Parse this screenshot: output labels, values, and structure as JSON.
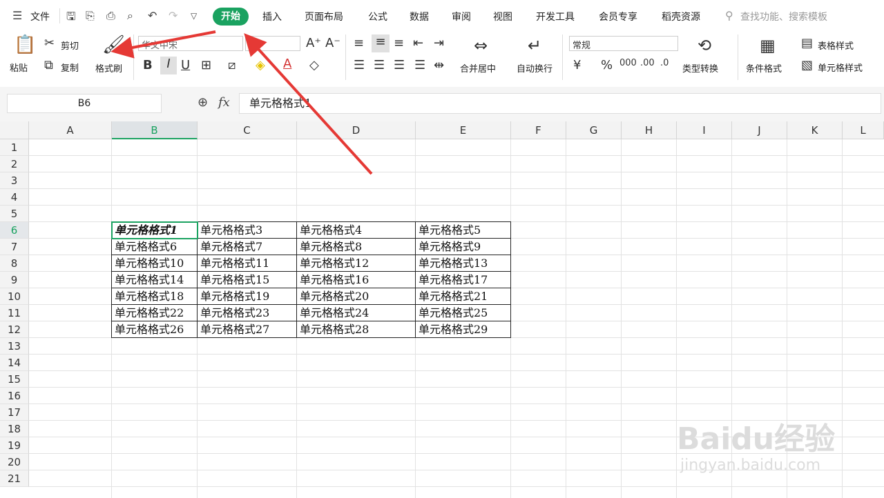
{
  "menu": {
    "file": "文件",
    "tabs": [
      "开始",
      "插入",
      "页面布局",
      "公式",
      "数据",
      "审阅",
      "视图",
      "开发工具",
      "会员专享",
      "稻壳资源"
    ],
    "search_placeholder": "查找功能、搜索模板"
  },
  "ribbon": {
    "paste": "粘贴",
    "cut": "剪切",
    "copy": "复制",
    "format_painter": "格式刷",
    "font_name": "华文中宋",
    "font_size": "",
    "merge_center": "合并居中",
    "auto_wrap": "自动换行",
    "number_format": "常规",
    "type_convert": "类型转换",
    "conditional_format": "条件格式",
    "table_style": "表格样式",
    "cell_style": "单元格样式"
  },
  "formula": {
    "name_box": "B6",
    "fx": "fx",
    "content": "单元格格式1"
  },
  "sheet": {
    "columns": [
      "A",
      "B",
      "C",
      "D",
      "E",
      "F",
      "G",
      "H",
      "I",
      "J",
      "K",
      "L"
    ],
    "rows": [
      "1",
      "2",
      "3",
      "4",
      "5",
      "6",
      "7",
      "8",
      "9",
      "10",
      "11",
      "12",
      "13",
      "14",
      "15",
      "16",
      "17",
      "18",
      "19",
      "20",
      "21"
    ],
    "table": [
      [
        "单元格格式1",
        "单元格格式3",
        "单元格格式4",
        "单元格格式5"
      ],
      [
        "单元格格式6",
        "单元格格式7",
        "单元格格式8",
        "单元格格式9"
      ],
      [
        "单元格格式10",
        "单元格格式11",
        "单元格格式12",
        "单元格格式13"
      ],
      [
        "单元格格式14",
        "单元格格式15",
        "单元格格式16",
        "单元格格式17"
      ],
      [
        "单元格格式18",
        "单元格格式19",
        "单元格格式20",
        "单元格格式21"
      ],
      [
        "单元格格式22",
        "单元格格式23",
        "单元格格式24",
        "单元格格式25"
      ],
      [
        "单元格格式26",
        "单元格格式27",
        "单元格格式28",
        "单元格格式29"
      ]
    ]
  },
  "watermark": {
    "brand": "Baidu经验",
    "url": "jingyan.baidu.com"
  },
  "colors": {
    "accent": "#1aa260",
    "arrow": "#e53935"
  }
}
